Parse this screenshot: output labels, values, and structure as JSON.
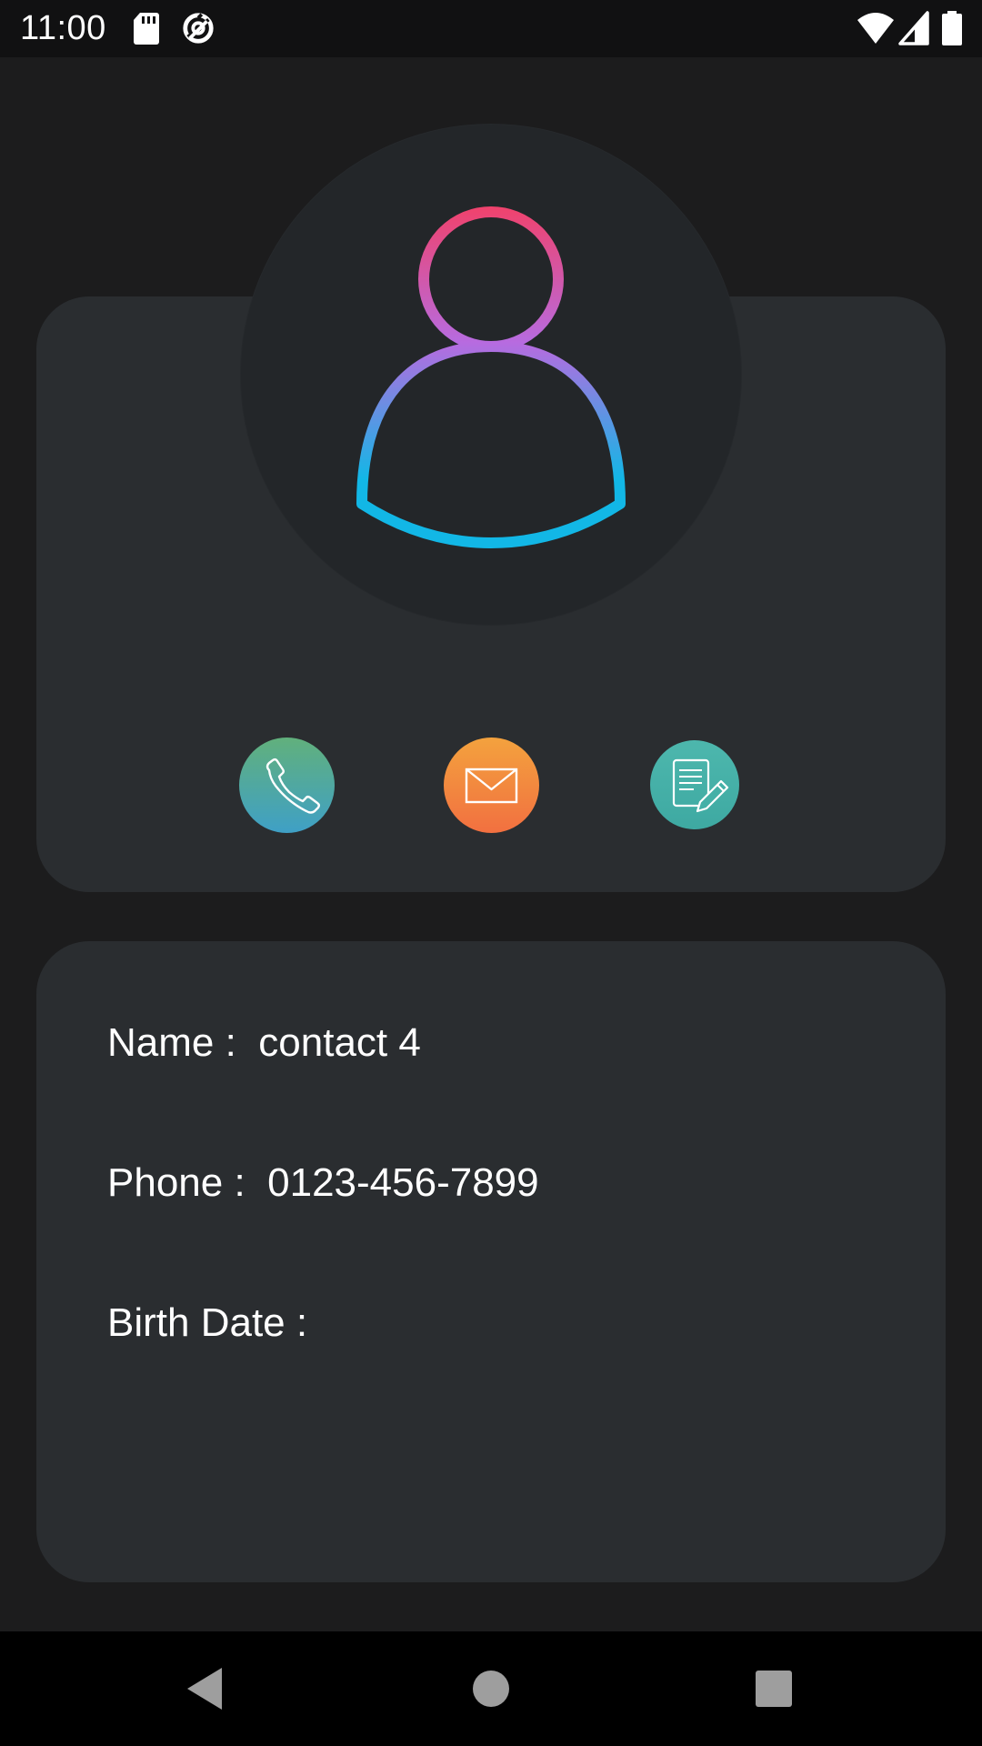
{
  "status_bar": {
    "time": "11:00",
    "icons": [
      "sd-card-icon",
      "data-saver-icon",
      "wifi-icon",
      "cell-signal-icon",
      "battery-icon"
    ]
  },
  "profile": {
    "avatar_icon": "person-outline-icon",
    "avatar_gradient": [
      "#f0426c",
      "#b76be0",
      "#12b7e6"
    ]
  },
  "actions": [
    {
      "name": "call",
      "icon": "phone-icon",
      "colors": [
        "#61b07c",
        "#3fa0c6"
      ]
    },
    {
      "name": "email",
      "icon": "envelope-icon",
      "colors": [
        "#f3a23e",
        "#f27040"
      ]
    },
    {
      "name": "edit",
      "icon": "edit-note-icon",
      "colors": [
        "#4db7ad",
        "#3ea9a2"
      ]
    }
  ],
  "details": {
    "name_label": "Name :",
    "name_value": "contact 4",
    "phone_label": "Phone :",
    "phone_value": "0123-456-7899",
    "birth_label": "Birth Date :",
    "birth_value": ""
  },
  "nav_bar": {
    "icons": [
      "back-icon",
      "home-icon",
      "recents-icon"
    ]
  }
}
